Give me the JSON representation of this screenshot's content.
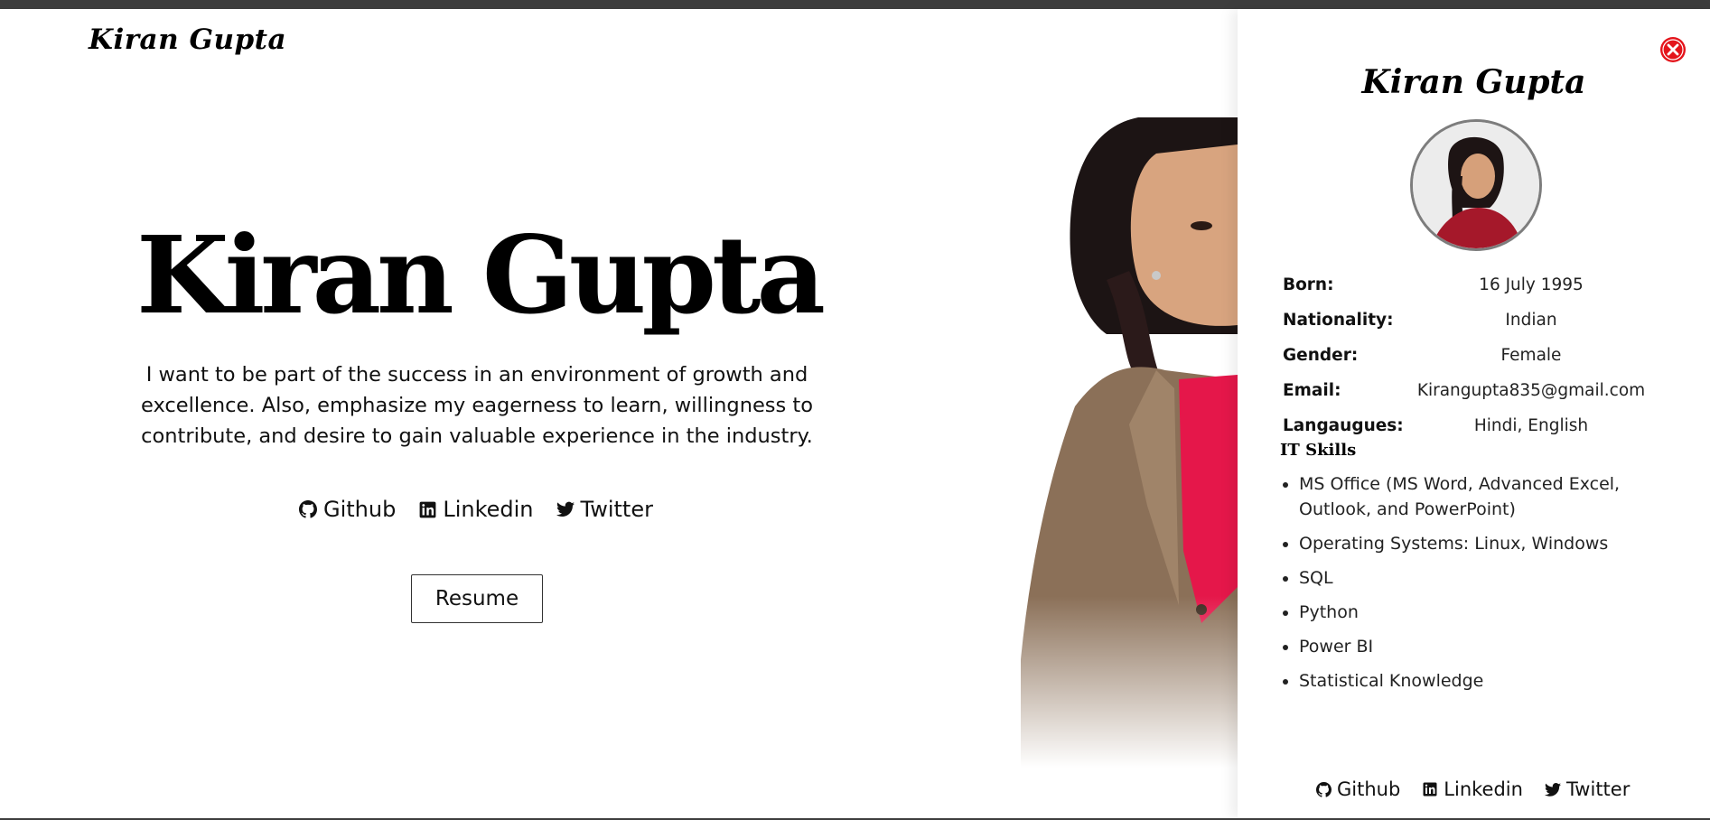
{
  "header": {
    "brand": "Kiran Gupta"
  },
  "hero": {
    "title": "Kiran Gupta",
    "tagline": "I want to be part of the success in an environment of growth and excellence. Also, emphasize my eagerness to learn, willingness to contribute, and desire to gain valuable experience in the industry.",
    "links": [
      {
        "label": "Github",
        "icon": "github-icon"
      },
      {
        "label": "Linkedin",
        "icon": "linkedin-icon"
      },
      {
        "label": "Twitter",
        "icon": "twitter-icon"
      }
    ],
    "resume_label": "Resume"
  },
  "panel": {
    "name": "Kiran Gupta",
    "details": [
      {
        "label": "Born:",
        "value": "16 July 1995"
      },
      {
        "label": "Nationality:",
        "value": "Indian"
      },
      {
        "label": "Gender:",
        "value": "Female"
      },
      {
        "label": "Email:",
        "value": "Kirangupta835@gmail.com"
      },
      {
        "label": "Langaugues:",
        "value": "Hindi, English"
      }
    ],
    "skills_title": "IT Skills",
    "skills": [
      "MS Office (MS Word, Advanced Excel, Outlook, and PowerPoint)",
      "Operating Systems: Linux, Windows",
      "SQL",
      "Python",
      "Power BI",
      "Statistical Knowledge"
    ],
    "links": [
      {
        "label": "Github",
        "icon": "github-icon"
      },
      {
        "label": "Linkedin",
        "icon": "linkedin-icon"
      },
      {
        "label": "Twitter",
        "icon": "twitter-icon"
      }
    ]
  },
  "colors": {
    "close_button": "#e4141b",
    "topbar": "#3d3d3d",
    "text": "#111111"
  }
}
